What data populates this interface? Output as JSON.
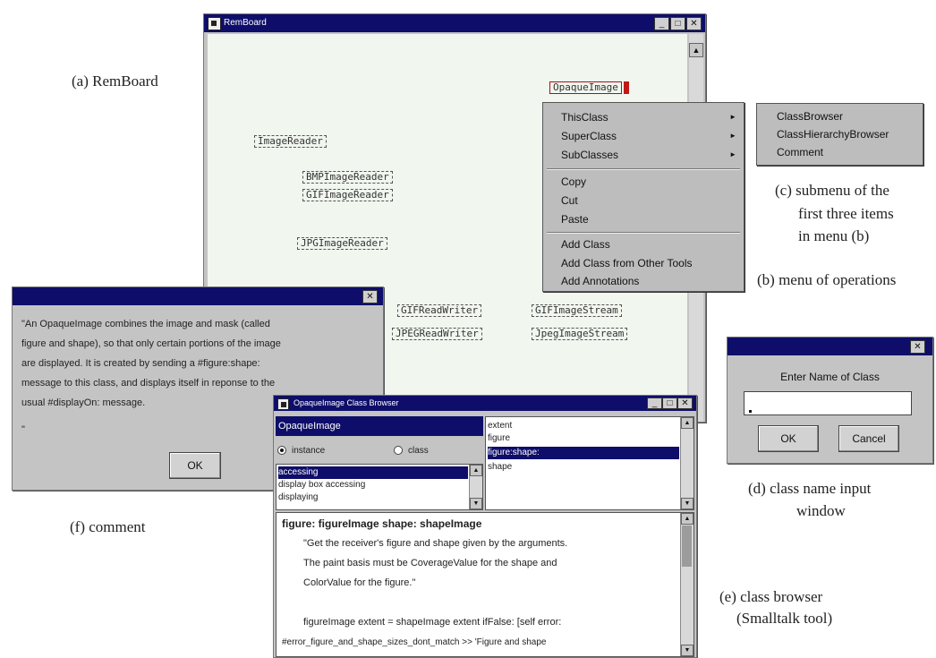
{
  "captions": {
    "a": "(a) RemBoard",
    "b": "(b) menu of operations",
    "c": [
      "(c) submenu of the",
      "first three items",
      "in menu (b)"
    ],
    "d": [
      "(d) class name input",
      "window"
    ],
    "e": [
      "(e) class browser",
      "(Smalltalk tool)"
    ],
    "f": "(f) comment"
  },
  "remboard": {
    "title": "RemBoard",
    "nodes": {
      "opaque": "OpaqueImage",
      "image_reader": "ImageReader",
      "bmp_reader": "BMPImageReader",
      "gif_reader": "GIFImageReader",
      "jpg_reader": "JPGImageReader",
      "gif_rw": "GIFReadWriter",
      "jpeg_rw": "JPEGReadWriter",
      "gif_stream": "GIFImageStream",
      "jpeg_stream": "JpegImageStream"
    }
  },
  "menu": {
    "items": [
      "ThisClass",
      "SuperClass",
      "SubClasses",
      "Copy",
      "Cut",
      "Paste",
      "Add Class",
      "Add Class from Other Tools",
      "Add Annotations"
    ],
    "submenu_arrow": "►"
  },
  "submenu": {
    "items": [
      "ClassBrowser",
      "ClassHierarchyBrowser",
      "Comment"
    ]
  },
  "comment": {
    "lines": [
      "\"An OpaqueImage combines the image and mask (called",
      "figure and shape), so that only certain portions of the image",
      "are displayed. It is created by sending a #figure:shape:",
      "message to this class, and displays itself in reponse to the",
      "usual #displayOn: message."
    ],
    "tail": "\"",
    "ok": "OK",
    "close": "✕"
  },
  "input_window": {
    "prompt": "Enter Name of Class",
    "ok": "OK",
    "cancel": "Cancel",
    "close": "✕"
  },
  "browser": {
    "title": "OpaqueImage Class Browser",
    "class_name": "OpaqueImage",
    "radio_instance": "instance",
    "radio_class": "class",
    "categories": [
      "accessing",
      "display box accessing",
      "displaying"
    ],
    "selectors": [
      "extent",
      "figure",
      "figure:shape:",
      "shape"
    ],
    "method_header": "figure: figureImage shape: shapeImage",
    "method_lines": [
      "\"Get the receiver's figure and shape given by the arguments.",
      "The paint basis must be CoverageValue for the shape and",
      "ColorValue for the figure.\"",
      "",
      "figureImage extent = shapeImage extent ifFalse: [self error:",
      "#error_figure_and_shape_sizes_dont_match >> 'Figure and shape"
    ]
  }
}
